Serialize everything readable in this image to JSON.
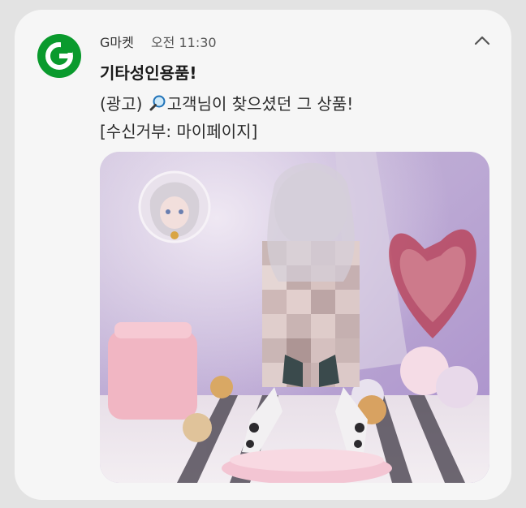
{
  "notification": {
    "app_name": "G마켓",
    "time": "오전 11:30",
    "title": "기타성인용품!",
    "ad_label": "(광고)",
    "message": "고객님이 찾으셨던 그 상품!",
    "opt_out": "[수신거부: 마이페이지]",
    "app_icon": "gmarket-logo-icon",
    "collapse_icon": "chevron-up-icon",
    "emoji_icon": "magnifier-icon",
    "accent_color": "#0a9a2d"
  }
}
